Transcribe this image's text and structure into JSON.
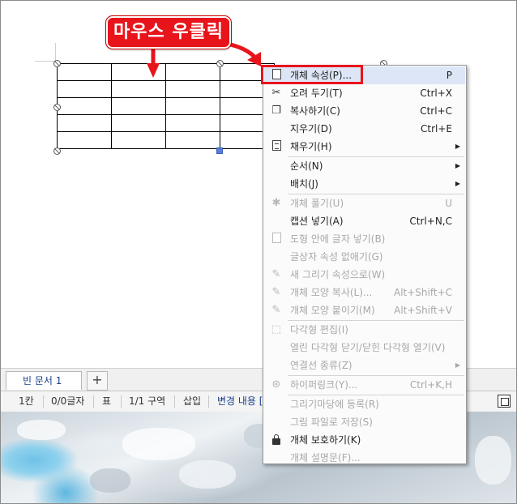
{
  "callout": {
    "text": "마우스 우클릭"
  },
  "tabs": {
    "document_tab": "빈 문서 1",
    "add_tab": "+"
  },
  "status": {
    "col": "1칸",
    "chars": "0/0글자",
    "object": "표",
    "section": "1/1 구역",
    "mode": "삽입",
    "track_changes": "변경 내용 ["
  },
  "menu": {
    "items": [
      {
        "label": "개체 속성(P)...",
        "shortcut": "P",
        "icon": "object-properties-icon",
        "enabled": true,
        "highlight": true
      },
      {
        "label": "오려 두기(T)",
        "shortcut": "Ctrl+X",
        "icon": "scissors-icon",
        "enabled": true
      },
      {
        "label": "복사하기(C)",
        "shortcut": "Ctrl+C",
        "icon": "copy-icon",
        "enabled": true
      },
      {
        "label": "지우기(D)",
        "shortcut": "Ctrl+E",
        "icon": "",
        "enabled": true
      },
      {
        "label": "채우기(H)",
        "shortcut": "",
        "icon": "fill-icon",
        "enabled": true,
        "submenu": true
      },
      {
        "label": "순서(N)",
        "shortcut": "",
        "icon": "",
        "enabled": true,
        "submenu": true
      },
      {
        "label": "배치(J)",
        "shortcut": "",
        "icon": "",
        "enabled": true,
        "submenu": true
      },
      {
        "label": "개체 풀기(U)",
        "shortcut": "U",
        "icon": "ungroup-icon",
        "enabled": false
      },
      {
        "label": "캡션 넣기(A)",
        "shortcut": "Ctrl+N,C",
        "icon": "",
        "enabled": true
      },
      {
        "label": "도형 안에 글자 넣기(B)",
        "shortcut": "",
        "icon": "text-in-shape-icon",
        "enabled": false
      },
      {
        "label": "글상자 속성 없애기(G)",
        "shortcut": "",
        "icon": "",
        "enabled": false
      },
      {
        "label": "새 그리기 속성으로(W)",
        "shortcut": "",
        "icon": "new-draw-props-icon",
        "enabled": false
      },
      {
        "label": "개체 모양 복사(L)...",
        "shortcut": "Alt+Shift+C",
        "icon": "copy-shape-icon",
        "enabled": false
      },
      {
        "label": "개체 모양 붙이기(M)",
        "shortcut": "Alt+Shift+V",
        "icon": "paste-shape-icon",
        "enabled": false
      },
      {
        "label": "다각형 편집(I)",
        "shortcut": "",
        "icon": "polygon-edit-icon",
        "enabled": false
      },
      {
        "label": "열린 다각형 닫기/닫힌 다각형 열기(V)",
        "shortcut": "",
        "icon": "",
        "enabled": false
      },
      {
        "label": "연결선 종류(Z)",
        "shortcut": "",
        "icon": "",
        "enabled": false,
        "submenu": true
      },
      {
        "label": "하이퍼링크(Y)...",
        "shortcut": "Ctrl+K,H",
        "icon": "hyperlink-icon",
        "enabled": false
      },
      {
        "label": "그리기마당에 등록(R)",
        "shortcut": "",
        "icon": "",
        "enabled": false
      },
      {
        "label": "그림 파일로 저장(S)",
        "shortcut": "",
        "icon": "",
        "enabled": false
      },
      {
        "label": "개체 보호하기(K)",
        "shortcut": "",
        "icon": "lock-icon",
        "enabled": true
      },
      {
        "label": "개체 설명문(F)...",
        "shortcut": "",
        "icon": "",
        "enabled": false
      }
    ]
  }
}
